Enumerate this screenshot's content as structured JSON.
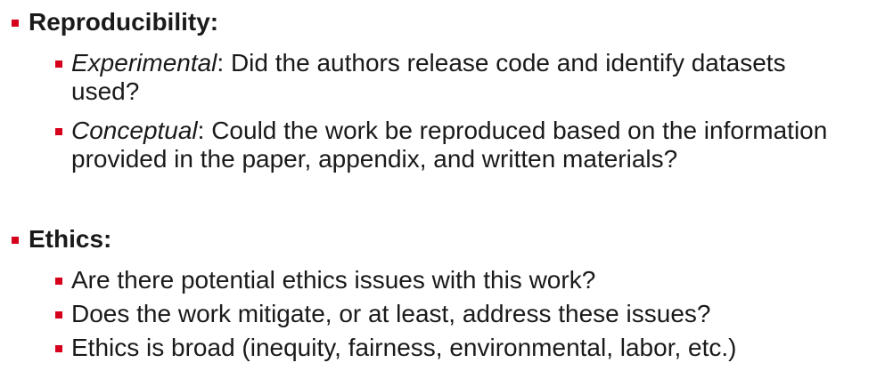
{
  "colors": {
    "bullet": "#d6001c",
    "text": "#1a1a1a"
  },
  "sections": [
    {
      "heading": "Reproducibility:",
      "items": [
        {
          "label": "Experimental",
          "text_line1": ": Did the authors release code and identify datasets",
          "text_line2": "used?"
        },
        {
          "label": "Conceptual",
          "text_line1": ": Could the work be reproduced based on the information",
          "text_line2": "provided in the paper, appendix, and written materials?"
        }
      ]
    },
    {
      "heading": "Ethics:",
      "items": [
        {
          "text": "Are there potential ethics issues with this work?"
        },
        {
          "text": "Does the work mitigate, or at least, address these issues?"
        },
        {
          "text": "Ethics is broad (inequity, fairness, environmental, labor, etc.)"
        }
      ]
    }
  ]
}
